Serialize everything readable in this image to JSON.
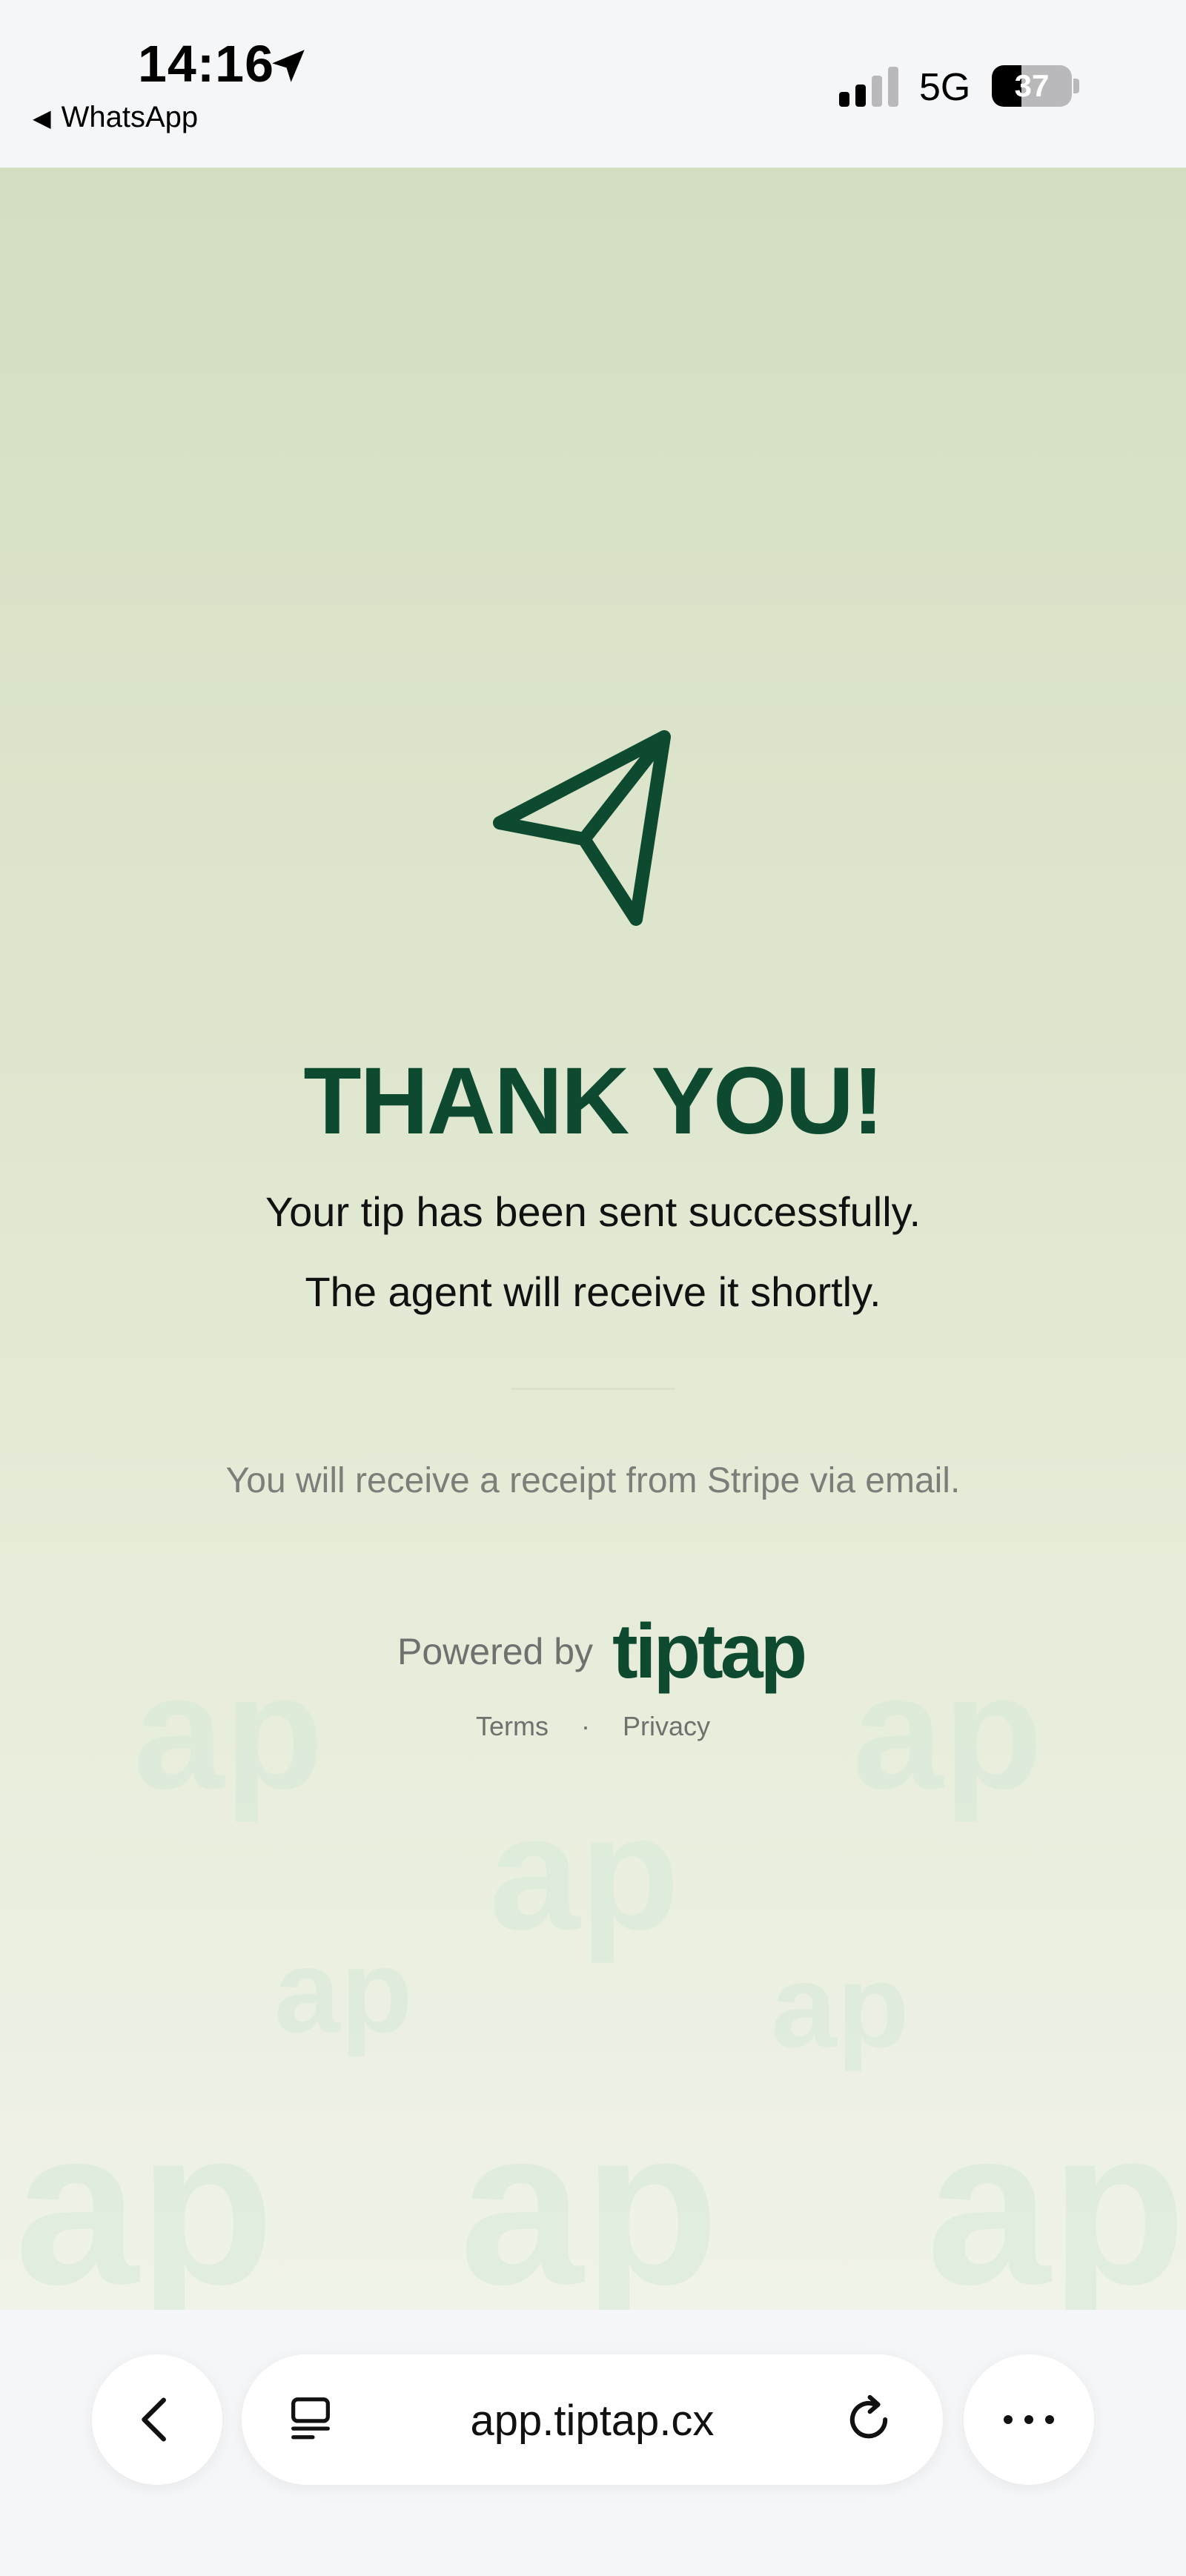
{
  "status_bar": {
    "time": "14:16",
    "back_app": "WhatsApp",
    "network": "5G",
    "battery": "37",
    "battery_level": 0.37
  },
  "main": {
    "title": "THANK YOU!",
    "message_line1": "Your tip has been sent successfully.",
    "message_line2": "The agent will receive it shortly.",
    "receipt_note": "You will receive a receipt from Stripe via email.",
    "powered_by": "Powered by",
    "brand_logo": "tiptap",
    "links": {
      "terms": "Terms",
      "separator": "·",
      "privacy": "Privacy"
    }
  },
  "browser_bar": {
    "url": "app.tiptap.cx"
  },
  "icons": {
    "location": "location-arrow-icon",
    "signal": "cellular-signal-icon",
    "hero": "paper-plane-icon",
    "back": "chevron-left-icon",
    "tabs": "tab-overview-icon",
    "reload": "reload-icon",
    "more": "more-dots-icon"
  },
  "colors": {
    "brand_green": "#0d4a30",
    "background_top": "#d4dfc1",
    "background_bottom": "#f0f3e8",
    "muted_text": "#7b7f79"
  }
}
